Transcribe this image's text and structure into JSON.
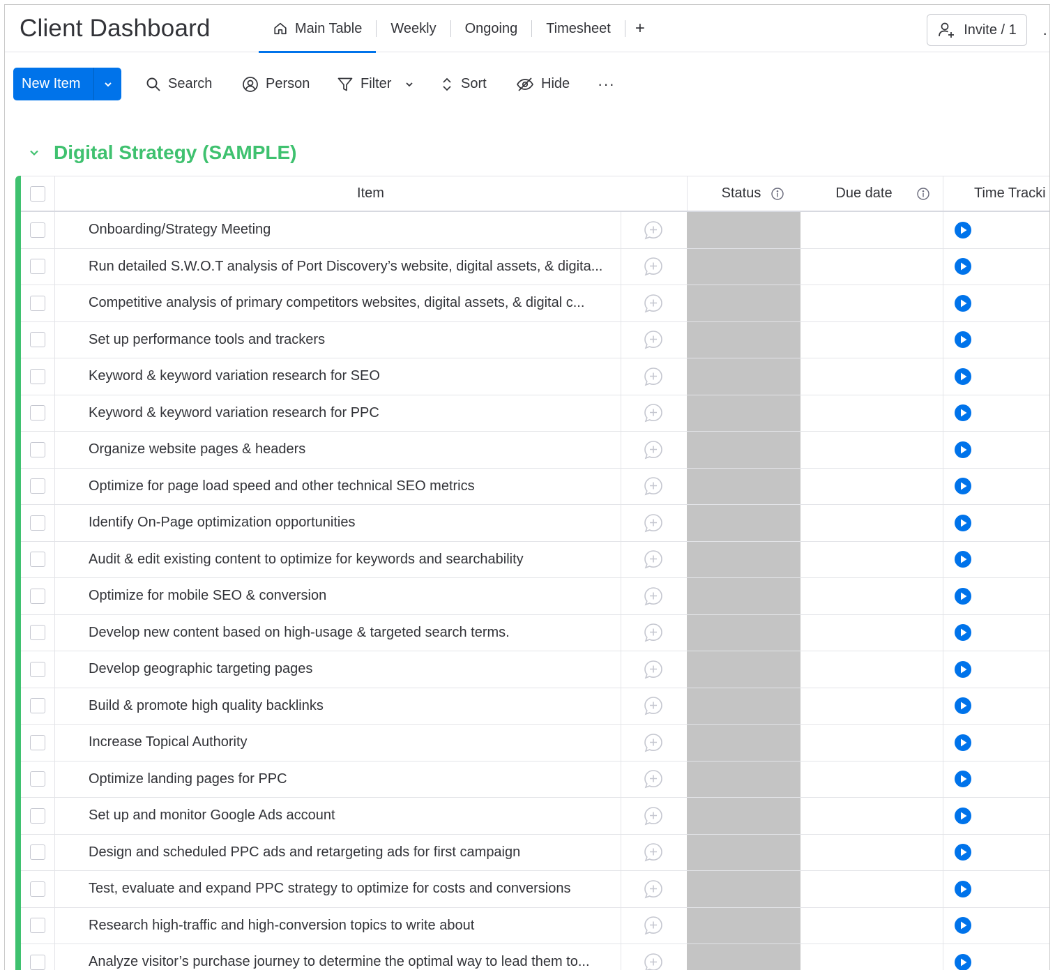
{
  "header": {
    "title": "Client Dashboard",
    "tabs": [
      {
        "label": "Main Table",
        "icon": "home-icon",
        "active": true
      },
      {
        "label": "Weekly"
      },
      {
        "label": "Ongoing"
      },
      {
        "label": "Timesheet"
      }
    ],
    "add_tab_label": "+",
    "invite_label": "Invite / 1",
    "more_label": "·"
  },
  "toolbar": {
    "new_item_label": "New Item",
    "search_label": "Search",
    "person_label": "Person",
    "filter_label": "Filter",
    "sort_label": "Sort",
    "hide_label": "Hide",
    "more_label": "···"
  },
  "group": {
    "name": "Digital Strategy (SAMPLE)",
    "color": "#3fc16f"
  },
  "columns": {
    "item": "Item",
    "status": "Status",
    "due_date": "Due date",
    "time_tracking": "Time Tracki"
  },
  "colors": {
    "accent": "#0073ea",
    "status_empty": "#c4c4c4"
  },
  "rows": [
    "Onboarding/Strategy Meeting",
    "Run detailed S.W.O.T analysis of Port Discovery’s website, digital assets, & digita...",
    "Competitive analysis of primary competitors websites, digital assets, & digital c...",
    "Set up performance tools and trackers",
    "Keyword & keyword variation research for SEO",
    "Keyword & keyword variation research for PPC",
    "Organize website pages & headers",
    "Optimize for page load speed and other technical SEO metrics",
    "Identify On-Page optimization opportunities",
    "Audit & edit existing content to optimize for keywords and searchability",
    "Optimize for mobile SEO & conversion",
    "Develop new content based on high-usage & targeted search terms.",
    "Develop geographic targeting pages",
    "Build & promote high quality backlinks",
    "Increase Topical Authority",
    "Optimize landing pages for PPC",
    "Set up and monitor Google Ads account",
    "Design and scheduled PPC ads and retargeting ads for first campaign",
    "Test, evaluate and expand PPC strategy to optimize for costs and conversions",
    "Research high-traffic and high-conversion topics to write about",
    "Analyze visitor’s purchase journey to determine the optimal way to lead them to..."
  ]
}
